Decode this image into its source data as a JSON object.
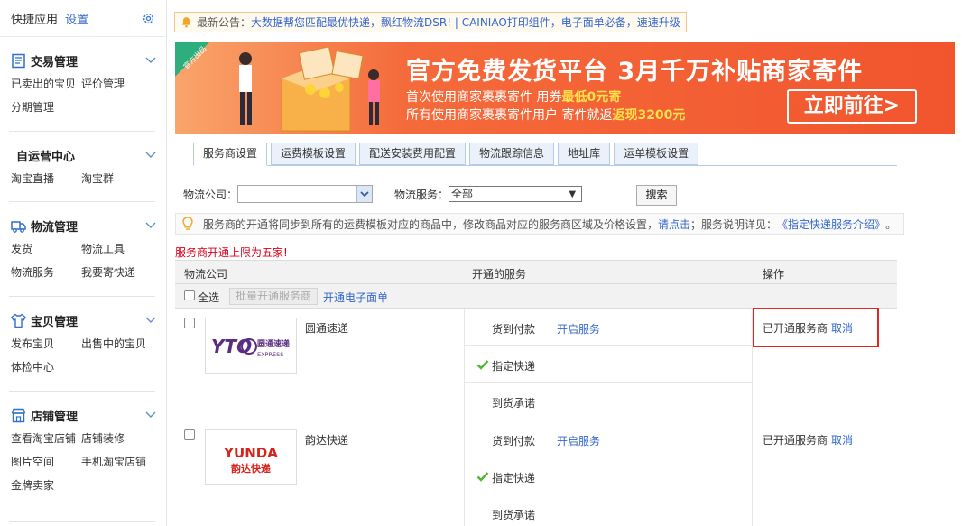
{
  "sidebar": {
    "quick_title": "快捷应用",
    "quick_settings": "设置",
    "sections": [
      {
        "title": "交易管理",
        "icon": "order-icon",
        "links": [
          "已卖出的宝贝",
          "评价管理",
          "分期管理"
        ]
      },
      {
        "title": "自运营中心",
        "icon": "",
        "links": [
          "淘宝直播",
          "淘宝群"
        ]
      },
      {
        "title": "物流管理",
        "icon": "truck-icon",
        "links": [
          "发货",
          "物流工具",
          "物流服务",
          "我要寄快递"
        ]
      },
      {
        "title": "宝贝管理",
        "icon": "shirt-icon",
        "links": [
          "发布宝贝",
          "出售中的宝贝",
          "体检中心"
        ]
      },
      {
        "title": "店铺管理",
        "icon": "store-icon",
        "links": [
          "查看淘宝店铺",
          "店铺装修",
          "图片空间",
          "手机淘宝店铺",
          "金牌卖家"
        ]
      }
    ]
  },
  "notice": {
    "label": "最新公告：",
    "message": "大数据帮您匹配最优快递，飘红物流DSR! | CAINIAO打印组件，电子面单必备，速速升级"
  },
  "banner": {
    "tag": "官方出品",
    "headline": "官方免费发货平台  3月千万补贴商家寄件",
    "line1_prefix": "首次使用商家裹裹寄件  用券",
    "line1_highlight": "最低0元寄",
    "line2_prefix": "所有使用商家裹裹寄件用户  寄件就返",
    "line2_highlight": "返现3200元",
    "cta": "立即前往>",
    "colors": {
      "bg": "#f46a3a",
      "highlight": "#ffe14d"
    }
  },
  "tabs": [
    "服务商设置",
    "运费模板设置",
    "配送安装费用配置",
    "物流跟踪信息",
    "地址库",
    "运单模板设置"
  ],
  "filter": {
    "company_label": "物流公司：",
    "company_value": "",
    "service_label": "物流服务：",
    "service_value": "全部",
    "search_button": "搜索"
  },
  "tip": {
    "text": "服务商的开通将同步到所有的运费模板对应的商品中，修改商品对应的服务商区域及价格设置，",
    "link1": "请点击",
    "mid": "；服务说明详见：",
    "link2": "《指定快递服务介绍》",
    "end": "。"
  },
  "limit_notice": "服务商开通上限为五家!",
  "table": {
    "headers": [
      "物流公司",
      "开通的服务",
      "操作"
    ],
    "select_all": "全选",
    "bulk_button": "批量开通服务商",
    "open_eface": "开通电子面单",
    "rows": [
      {
        "company": "圆通速递",
        "logo_text": "YTO",
        "logo_cn": "圆通速递",
        "logo_en": "EXPRESS",
        "services": [
          {
            "name": "货到付款",
            "action": "开启服务",
            "enabled": false
          },
          {
            "name": "指定快递",
            "action": "",
            "enabled": true
          },
          {
            "name": "到货承诺",
            "action": "",
            "enabled": false
          }
        ],
        "status": "已开通服务商",
        "op": "取消"
      },
      {
        "company": "韵达快递",
        "logo_text": "YUNDA",
        "logo_cn": "韵达快递",
        "logo_en": "",
        "services": [
          {
            "name": "货到付款",
            "action": "开启服务",
            "enabled": false
          },
          {
            "name": "指定快递",
            "action": "",
            "enabled": true
          },
          {
            "name": "到货承诺",
            "action": "",
            "enabled": false
          }
        ],
        "status": "已开通服务商",
        "op": "取消"
      }
    ]
  }
}
